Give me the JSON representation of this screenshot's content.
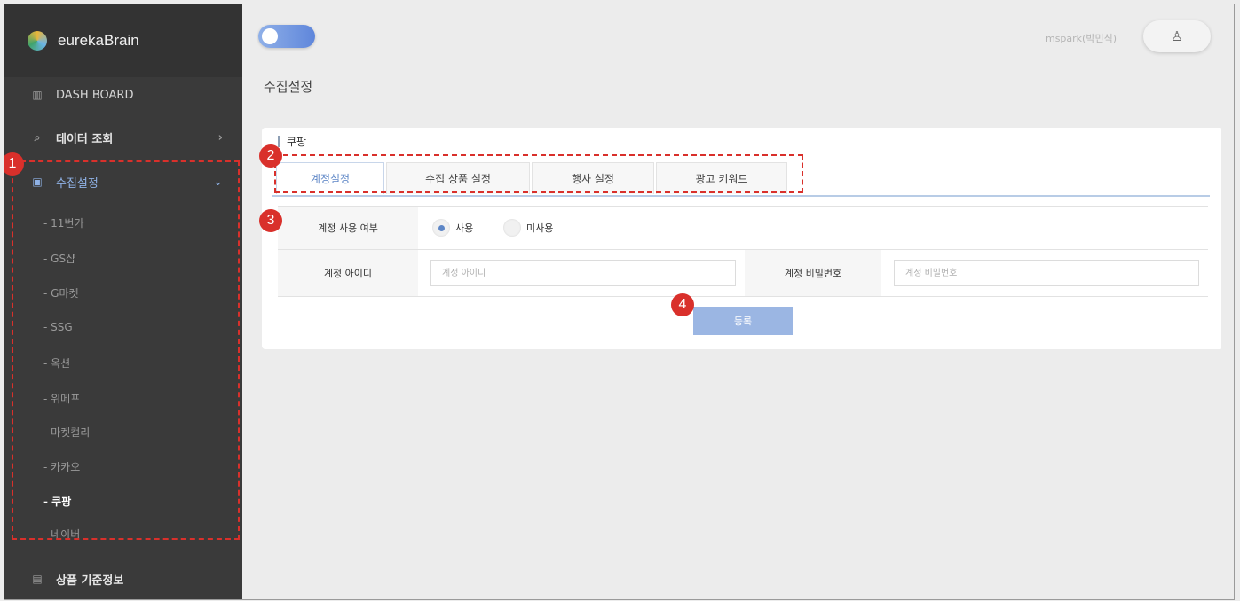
{
  "sidebar": {
    "brand": "eurekaBrain",
    "menu": [
      {
        "label": "DASH BOARD",
        "icon": "bar-chart-icon"
      },
      {
        "label": "데이터 조회",
        "icon": "search-icon"
      },
      {
        "label": "수집설정",
        "icon": "settings-doc-icon"
      },
      {
        "label": "상품 기준정보",
        "icon": "doc-icon"
      }
    ],
    "sub_items": [
      "- 11번가",
      "- GS샵",
      "- G마켓",
      "- SSG",
      "- 옥션",
      "- 위메프",
      "- 마켓컬리",
      "- 카카오",
      "- 쿠팡",
      "- 네이버"
    ],
    "active_sub_index": 8
  },
  "header": {
    "user": "mspark(박민식)",
    "user_icon": "user-icon"
  },
  "page": {
    "title": "수집설정",
    "card_title": "쿠팡",
    "tabs": [
      "계정설정",
      "수집 상품 설정",
      "행사 설정",
      "광고 키워드"
    ],
    "active_tab": 0,
    "form": {
      "use_label": "계정 사용 여부",
      "radio_use": "사용",
      "radio_not_use": "미사용",
      "radio_selected": "사용",
      "id_label": "계정 아이디",
      "id_placeholder": "계정 아이디",
      "pw_label": "계정 비밀번호",
      "pw_placeholder": "계정 비밀번호",
      "submit": "등록"
    }
  },
  "annotations": [
    "1",
    "2",
    "3",
    "4"
  ],
  "colors": {
    "sidebar_bg": "#3a3a3a",
    "accent": "#5d86c6",
    "annotation": "#d9302b",
    "button": "#9bb6e3"
  }
}
